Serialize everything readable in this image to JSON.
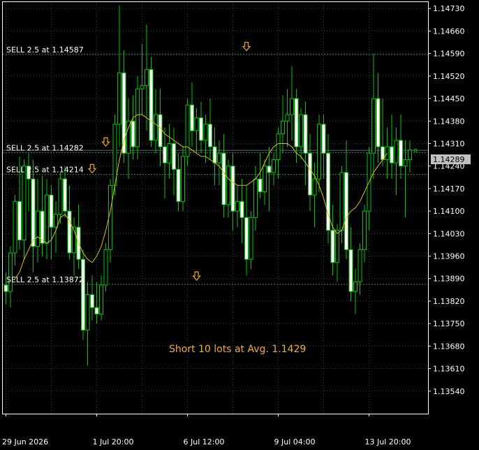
{
  "colors": {
    "background": "#000000",
    "grid": "#2a3a4a",
    "axis": "#ffffff",
    "candle": "#00c800",
    "candle_bull_body": "#000000",
    "candle_bear_body": "#ffffff",
    "moving_average": "#e0c000",
    "trade_line": "#2e8b57",
    "marker": "#e0a000",
    "summary_text": "#f0b020",
    "price_tag_bg": "#c0c0c0"
  },
  "summary_text": "Short 10 lots at Avg. 1.1429",
  "current_price_label": "1.14289",
  "chart_data": {
    "type": "candlestick",
    "ylim": [
      1.1347,
      1.1475
    ],
    "y_ticks": [
      "1.14730",
      "1.14660",
      "1.14590",
      "1.14520",
      "1.14450",
      "1.14380",
      "1.14310",
      "1.14240",
      "1.14170",
      "1.14100",
      "1.14030",
      "1.13960",
      "1.13890",
      "1.13820",
      "1.13750",
      "1.13680",
      "1.13610",
      "1.13540"
    ],
    "y_tick_values": [
      1.1473,
      1.1466,
      1.1459,
      1.1452,
      1.1445,
      1.1438,
      1.1431,
      1.1424,
      1.1417,
      1.141,
      1.1403,
      1.1396,
      1.1389,
      1.1382,
      1.1375,
      1.1368,
      1.1361,
      1.1354
    ],
    "x_labels": [
      {
        "index": 0,
        "text": "29 Jun 2026"
      },
      {
        "index": 20,
        "text": "1 Jul 20:00"
      },
      {
        "index": 40,
        "text": "6 Jul 12:00"
      },
      {
        "index": 60,
        "text": "9 Jul 04:00"
      },
      {
        "index": 80,
        "text": "13 Jul 20:00"
      }
    ],
    "current_price": 1.14289,
    "sell_orders": [
      {
        "label": "SELL 2.5 at 1.14587",
        "price": 1.14587
      },
      {
        "label": "SELL 2.5 at 1.14282",
        "price": 1.14282
      },
      {
        "label": "SELL 2.5 at 1.14214",
        "price": 1.14214
      },
      {
        "label": "SELL 2.5 at 1.13872",
        "price": 1.13872
      }
    ],
    "markers": [
      {
        "index": 53,
        "price": 1.14612
      },
      {
        "index": 22,
        "price": 1.14315
      },
      {
        "index": 19,
        "price": 1.14232
      },
      {
        "index": 42,
        "price": 1.13898
      }
    ],
    "candles": [
      [
        1.1387,
        1.1391,
        1.1381,
        1.1385
      ],
      [
        1.1385,
        1.1399,
        1.138,
        1.1397
      ],
      [
        1.1397,
        1.1415,
        1.1393,
        1.1413
      ],
      [
        1.1413,
        1.1427,
        1.1398,
        1.1401
      ],
      [
        1.1401,
        1.1426,
        1.1395,
        1.1424
      ],
      [
        1.1424,
        1.1428,
        1.141,
        1.142
      ],
      [
        1.142,
        1.1426,
        1.1391,
        1.1399
      ],
      [
        1.1399,
        1.142,
        1.1394,
        1.141
      ],
      [
        1.141,
        1.1421,
        1.1396,
        1.14
      ],
      [
        1.14,
        1.142,
        1.1395,
        1.1415
      ],
      [
        1.1415,
        1.1418,
        1.1395,
        1.1405
      ],
      [
        1.1405,
        1.1413,
        1.1397,
        1.1409
      ],
      [
        1.1409,
        1.1422,
        1.1406,
        1.142
      ],
      [
        1.142,
        1.1424,
        1.1408,
        1.141
      ],
      [
        1.141,
        1.1418,
        1.1395,
        1.1397
      ],
      [
        1.1397,
        1.1408,
        1.139,
        1.1405
      ],
      [
        1.1405,
        1.1412,
        1.1392,
        1.1395
      ],
      [
        1.1395,
        1.1398,
        1.137,
        1.1373
      ],
      [
        1.1373,
        1.1388,
        1.1362,
        1.1384
      ],
      [
        1.1384,
        1.139,
        1.1376,
        1.138
      ],
      [
        1.138,
        1.1388,
        1.1375,
        1.1378
      ],
      [
        1.1378,
        1.139,
        1.1376,
        1.1387
      ],
      [
        1.1387,
        1.14,
        1.1385,
        1.1398
      ],
      [
        1.1398,
        1.142,
        1.1394,
        1.1418
      ],
      [
        1.1418,
        1.144,
        1.1415,
        1.1437
      ],
      [
        1.1437,
        1.1474,
        1.143,
        1.1453
      ],
      [
        1.1453,
        1.146,
        1.1425,
        1.1428
      ],
      [
        1.1428,
        1.1445,
        1.142,
        1.1438
      ],
      [
        1.1438,
        1.1446,
        1.1426,
        1.143
      ],
      [
        1.143,
        1.1452,
        1.1426,
        1.1448
      ],
      [
        1.1448,
        1.1462,
        1.144,
        1.1449
      ],
      [
        1.1449,
        1.1468,
        1.1435,
        1.1454
      ],
      [
        1.1454,
        1.1458,
        1.143,
        1.1432
      ],
      [
        1.1432,
        1.1448,
        1.1428,
        1.144
      ],
      [
        1.144,
        1.1448,
        1.1424,
        1.143
      ],
      [
        1.143,
        1.1436,
        1.1414,
        1.1425
      ],
      [
        1.1425,
        1.1437,
        1.142,
        1.1431
      ],
      [
        1.1431,
        1.1436,
        1.1415,
        1.1423
      ],
      [
        1.1423,
        1.1428,
        1.141,
        1.1413
      ],
      [
        1.1413,
        1.143,
        1.141,
        1.1427
      ],
      [
        1.1427,
        1.1445,
        1.1424,
        1.1443
      ],
      [
        1.1443,
        1.145,
        1.143,
        1.1435
      ],
      [
        1.1435,
        1.1442,
        1.1428,
        1.1439
      ],
      [
        1.1439,
        1.1444,
        1.1428,
        1.1432
      ],
      [
        1.1432,
        1.144,
        1.1425,
        1.1437
      ],
      [
        1.1437,
        1.1445,
        1.1426,
        1.143
      ],
      [
        1.143,
        1.1436,
        1.1418,
        1.1425
      ],
      [
        1.1425,
        1.1432,
        1.1418,
        1.1428
      ],
      [
        1.1428,
        1.1434,
        1.1408,
        1.1412
      ],
      [
        1.1412,
        1.1426,
        1.1408,
        1.1424
      ],
      [
        1.1424,
        1.1428,
        1.1404,
        1.141
      ],
      [
        1.141,
        1.1418,
        1.1405,
        1.1413
      ],
      [
        1.1413,
        1.142,
        1.14,
        1.1408
      ],
      [
        1.1408,
        1.1418,
        1.139,
        1.1395
      ],
      [
        1.1395,
        1.141,
        1.1392,
        1.1408
      ],
      [
        1.1408,
        1.1424,
        1.1404,
        1.142
      ],
      [
        1.142,
        1.1428,
        1.1414,
        1.1416
      ],
      [
        1.1416,
        1.1426,
        1.1412,
        1.1424
      ],
      [
        1.1424,
        1.143,
        1.141,
        1.1422
      ],
      [
        1.1422,
        1.1428,
        1.1418,
        1.1426
      ],
      [
        1.1426,
        1.1436,
        1.142,
        1.1434
      ],
      [
        1.1434,
        1.1446,
        1.1428,
        1.1438
      ],
      [
        1.1438,
        1.1448,
        1.143,
        1.144
      ],
      [
        1.144,
        1.1455,
        1.1432,
        1.1445
      ],
      [
        1.1445,
        1.1448,
        1.1425,
        1.143
      ],
      [
        1.143,
        1.1442,
        1.1426,
        1.144
      ],
      [
        1.144,
        1.1444,
        1.1418,
        1.1428
      ],
      [
        1.1428,
        1.1434,
        1.141,
        1.1415
      ],
      [
        1.1415,
        1.1425,
        1.1405,
        1.142
      ],
      [
        1.142,
        1.144,
        1.1416,
        1.1437
      ],
      [
        1.1437,
        1.144,
        1.142,
        1.1428
      ],
      [
        1.1428,
        1.1434,
        1.14,
        1.1404
      ],
      [
        1.1404,
        1.1412,
        1.139,
        1.1394
      ],
      [
        1.1394,
        1.1406,
        1.1388,
        1.1404
      ],
      [
        1.1404,
        1.1424,
        1.14,
        1.1422
      ],
      [
        1.1422,
        1.1432,
        1.1395,
        1.1398
      ],
      [
        1.1398,
        1.1405,
        1.1382,
        1.1385
      ],
      [
        1.1385,
        1.1392,
        1.1378,
        1.1388
      ],
      [
        1.1388,
        1.14,
        1.1384,
        1.1398
      ],
      [
        1.1398,
        1.1412,
        1.1394,
        1.141
      ],
      [
        1.141,
        1.143,
        1.1404,
        1.1428
      ],
      [
        1.1428,
        1.1459,
        1.142,
        1.1445
      ],
      [
        1.1445,
        1.1453,
        1.1425,
        1.143
      ],
      [
        1.143,
        1.1445,
        1.1424,
        1.1426
      ],
      [
        1.1426,
        1.1436,
        1.142,
        1.143
      ],
      [
        1.143,
        1.144,
        1.142,
        1.1425
      ],
      [
        1.1425,
        1.1436,
        1.1415,
        1.1432
      ],
      [
        1.1432,
        1.144,
        1.142,
        1.1424
      ],
      [
        1.1424,
        1.1432,
        1.1408,
        1.1426
      ],
      [
        1.1426,
        1.1432,
        1.1422,
        1.1429
      ]
    ],
    "moving_average": [
      1.1389,
      1.1391,
      1.1395,
      1.1398,
      1.1401,
      1.1402,
      1.1401,
      1.14,
      1.1401,
      1.1404,
      1.1408,
      1.1409,
      1.1407,
      1.1404,
      1.14,
      1.1397,
      1.1395,
      1.1394,
      1.1396,
      1.1399,
      1.1404,
      1.141,
      1.1418,
      1.1426,
      1.1432,
      1.1436,
      1.1439,
      1.144,
      1.144,
      1.1439,
      1.1438,
      1.1437,
      1.1436,
      1.1434,
      1.1433,
      1.1432,
      1.1431,
      1.143,
      1.143,
      1.1429,
      1.1428,
      1.1427,
      1.1427,
      1.1426,
      1.1425,
      1.1424,
      1.1422,
      1.142,
      1.1419,
      1.1418,
      1.1418,
      1.1418,
      1.1419,
      1.142,
      1.1422,
      1.1425,
      1.1428,
      1.143,
      1.1431,
      1.1431,
      1.1431,
      1.143,
      1.1428,
      1.1427,
      1.1425,
      1.1423,
      1.1421,
      1.1418,
      1.1414,
      1.1409,
      1.1405,
      1.1403,
      1.1404,
      1.1408,
      1.141,
      1.1411,
      1.1413,
      1.1416,
      1.1419,
      1.1422,
      1.1424,
      1.1426,
      1.1428
    ]
  }
}
